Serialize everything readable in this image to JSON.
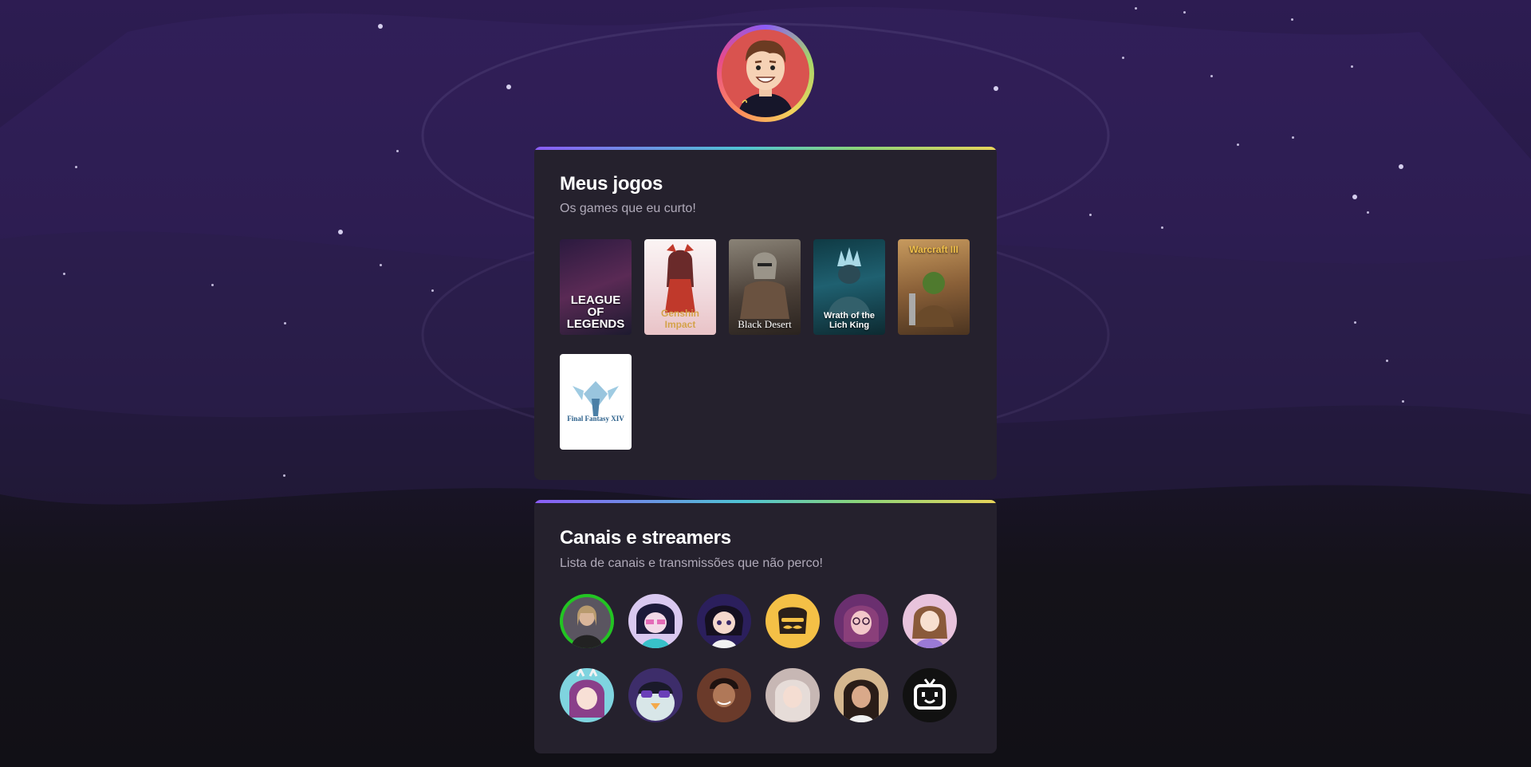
{
  "profile": {
    "avatar_icon": "cartoon-avatar-icon"
  },
  "games_section": {
    "title": "Meus jogos",
    "subtitle": "Os games que eu curto!",
    "games": [
      {
        "name": "LEAGUE OF LEGENDS",
        "color": "#3a1f45"
      },
      {
        "name": "Genshin Impact",
        "color": "#f3e7ea"
      },
      {
        "name": "Black Desert",
        "color": "#5b5148"
      },
      {
        "name": "Wrath of the Lich King",
        "color": "#1f4f5a"
      },
      {
        "name": "Warcraft III",
        "color": "#7a5a35"
      },
      {
        "name": "Final Fantasy XIV",
        "color": "#ffffff"
      }
    ]
  },
  "channels_section": {
    "title": "Canais e streamers",
    "subtitle": "Lista de canais e transmissões que não perco!",
    "channels": [
      {
        "icon": "streamer-avatar-1",
        "color": "#5a5560",
        "live": true
      },
      {
        "icon": "streamer-avatar-2",
        "color": "#d9c8f0"
      },
      {
        "icon": "streamer-avatar-3",
        "color": "#2b1f5c"
      },
      {
        "icon": "mustache-toast-icon",
        "color": "#f4c046"
      },
      {
        "icon": "streamer-avatar-5",
        "color": "#6a2f6f"
      },
      {
        "icon": "streamer-avatar-6",
        "color": "#e8c3dc"
      },
      {
        "icon": "streamer-avatar-7",
        "color": "#7fd4df"
      },
      {
        "icon": "penguin-sunglasses-icon",
        "color": "#3d2d6a"
      },
      {
        "icon": "streamer-avatar-9",
        "color": "#6a3a2a"
      },
      {
        "icon": "streamer-avatar-10",
        "color": "#c7b7b4"
      },
      {
        "icon": "streamer-avatar-11",
        "color": "#d5b78f"
      },
      {
        "icon": "tv-robot-icon",
        "color": "#111111"
      }
    ]
  }
}
